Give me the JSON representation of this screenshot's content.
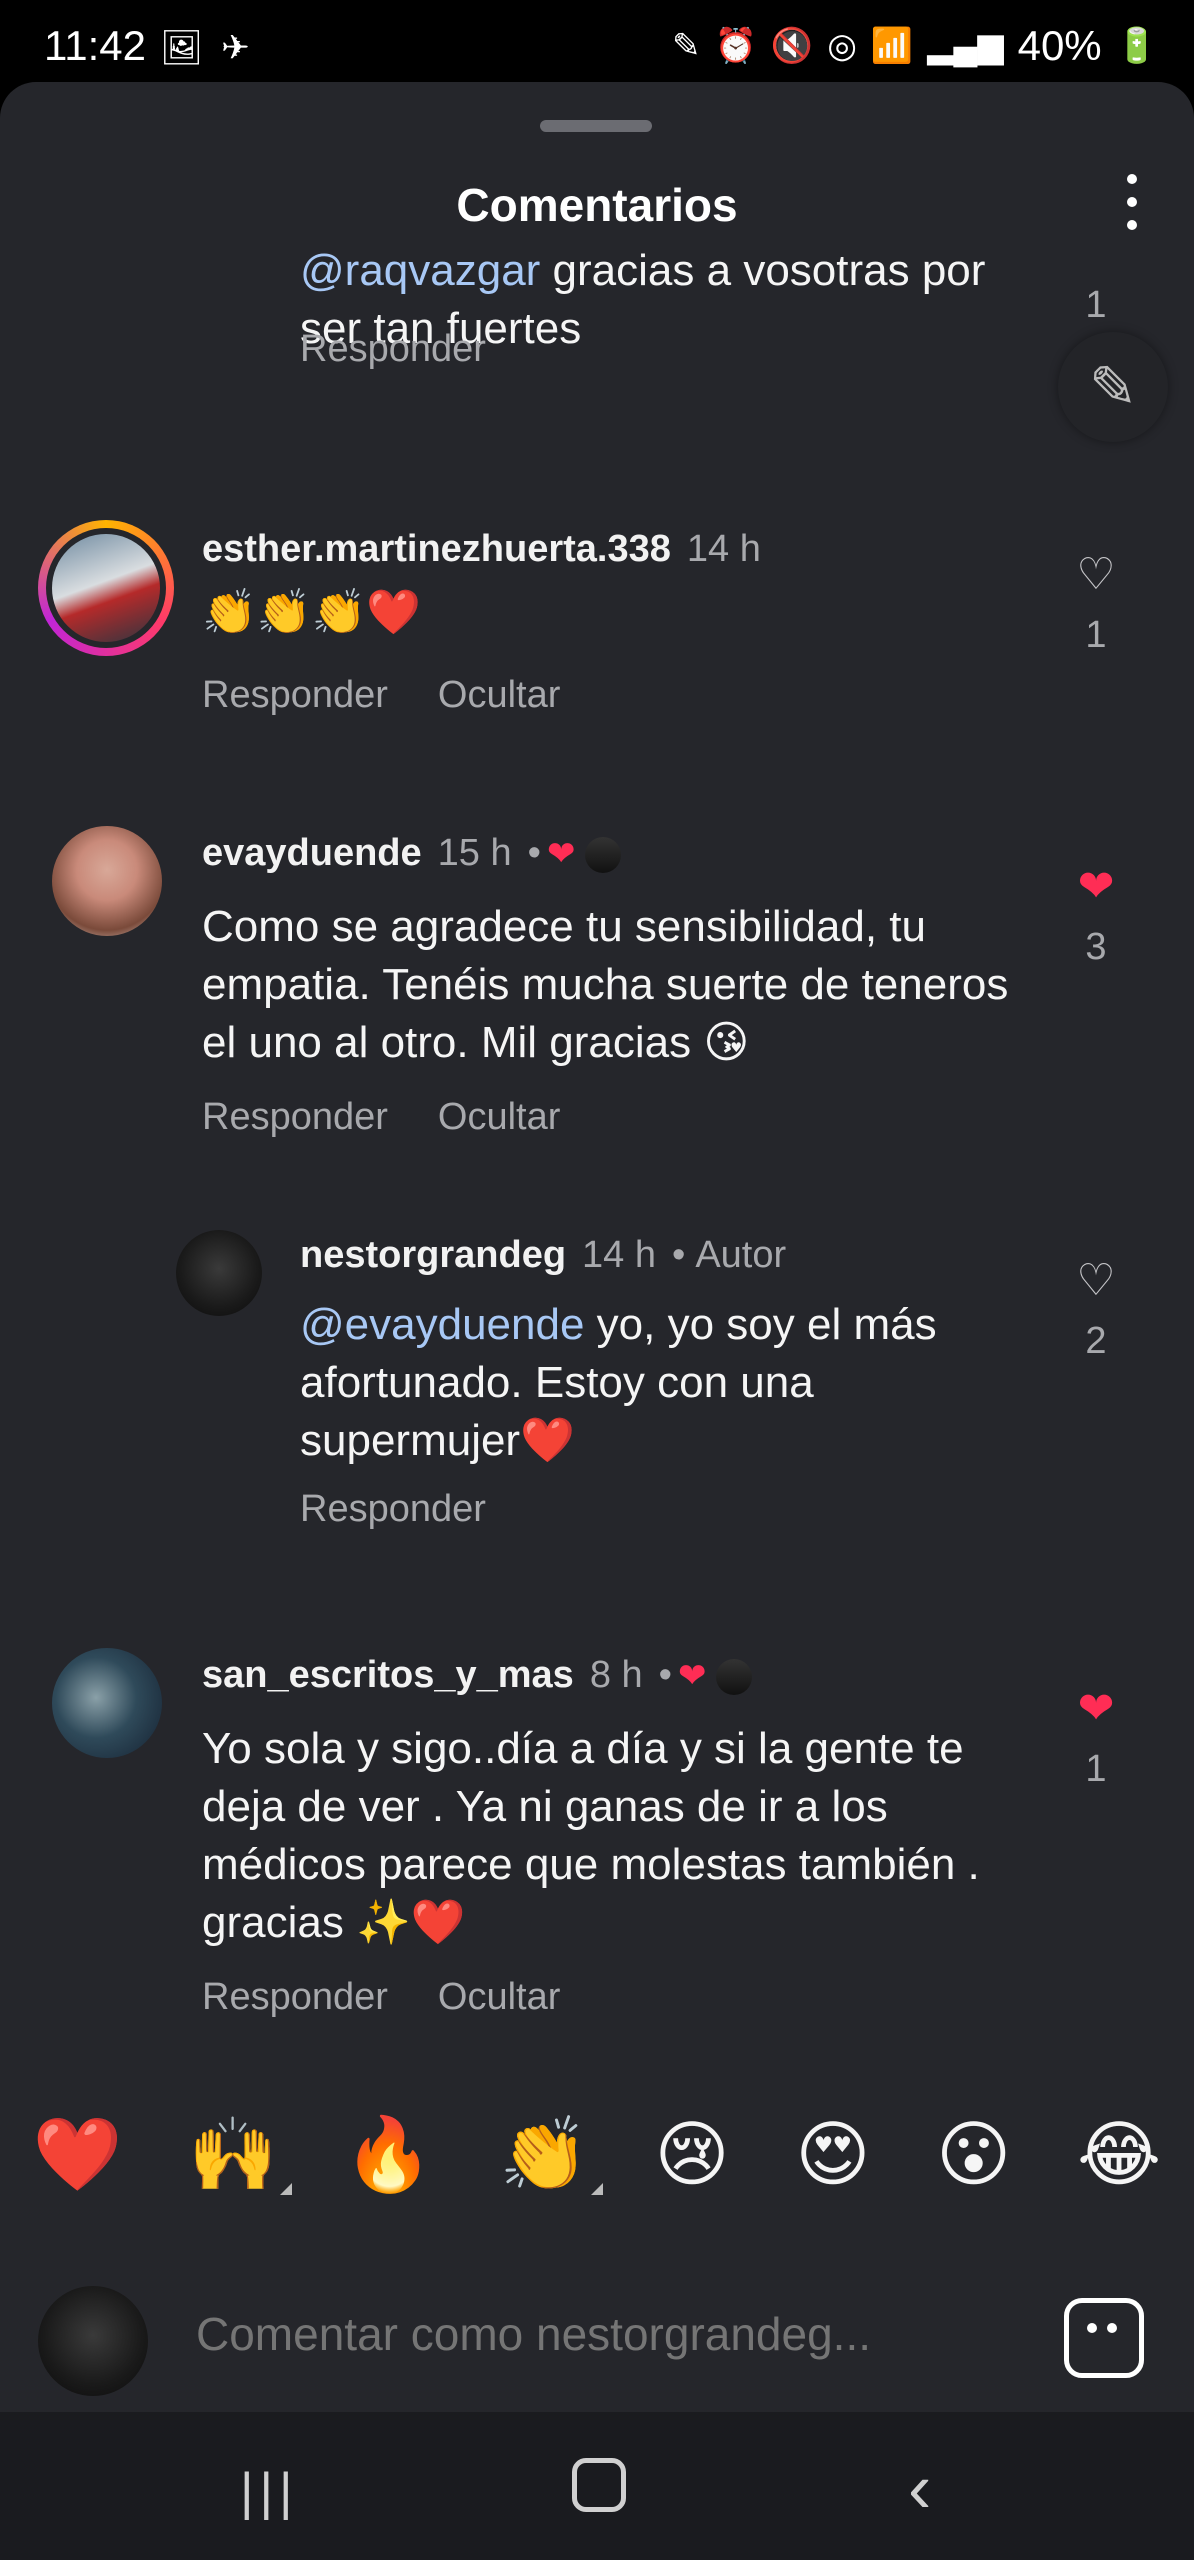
{
  "status_bar": {
    "time": "11:42",
    "left_icons": [
      "image-icon",
      "airplane-stripes-icon"
    ],
    "right_icons": [
      "pen-icon",
      "alarm-icon",
      "mute-icon",
      "hotspot-icon",
      "wifi-icon",
      "signal-icon"
    ],
    "battery": "40%"
  },
  "sheet": {
    "title": "Comentarios"
  },
  "comments": [
    {
      "id": "c0",
      "text_mention": "@raqvazgar",
      "text_rest": " gracias a vosotras por ser tan fuertes",
      "reply_label": "Responder",
      "like_count": "1"
    },
    {
      "id": "c1",
      "username": "esther.martinezhuerta.338",
      "time": "14 h",
      "text": "👏👏👏❤️",
      "reply_label": "Responder",
      "hide_label": "Ocultar",
      "like_count": "1",
      "liked": false
    },
    {
      "id": "c2",
      "username": "evayduende",
      "time": "15 h",
      "text": "Como se agradece tu sensibilidad, tu empatia. Tenéis mucha suerte de teneros el uno al otro. Mil gracias 😘",
      "reply_label": "Responder",
      "hide_label": "Ocultar",
      "like_count": "3",
      "liked": true
    },
    {
      "id": "c3",
      "username": "nestorgrandeg",
      "time": "14 h",
      "author_label": "Autor",
      "text_mention": "@evayduende",
      "text_rest": " yo, yo soy el más afortunado. Estoy con una supermujer❤️",
      "reply_label": "Responder",
      "like_count": "2",
      "liked": false
    },
    {
      "id": "c4",
      "username": "san_escritos_y_mas",
      "time": "8 h",
      "text": "Yo sola y sigo..día a día y si la gente te deja de ver . Ya ni ganas de ir a los médicos parece que molestas también . gracias ✨❤️",
      "reply_label": "Responder",
      "hide_label": "Ocultar",
      "like_count": "1",
      "liked": true
    }
  ],
  "quick_reactions": [
    "❤️",
    "🙌",
    "🔥",
    "👏",
    "😢",
    "😍",
    "😮",
    "😂"
  ],
  "composer": {
    "placeholder": "Comentar como nestorgrandeg..."
  },
  "colors": {
    "sheet_bg": "#25262b",
    "like_red": "#ff2d55",
    "mention_blue": "#a8c8f5"
  }
}
